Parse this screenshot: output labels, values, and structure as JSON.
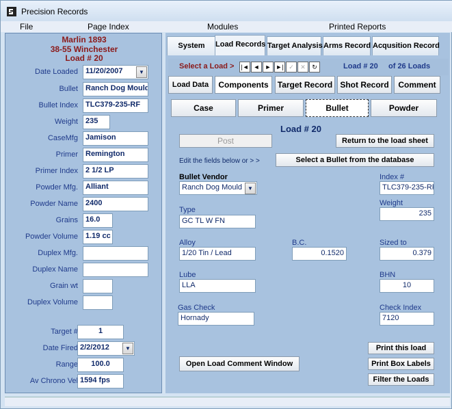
{
  "title": "Precision Records",
  "menu": [
    "File",
    "Page Index",
    "Modules",
    "Printed Reports"
  ],
  "left": {
    "heading1": "Marlin 1893",
    "heading2": "38-55 Winchester",
    "heading3": "Load #  20",
    "rows": [
      {
        "label": "Date Loaded",
        "value": "11/20/2007"
      },
      {
        "label": "Bullet",
        "value": "Ranch Dog Mould"
      },
      {
        "label": "Bullet Index",
        "value": "TLC379-235-RF"
      },
      {
        "label": "Weight",
        "value": "235"
      },
      {
        "label": "CaseMfg",
        "value": "Jamison"
      },
      {
        "label": "Primer",
        "value": "Remington"
      },
      {
        "label": "Primer Index",
        "value": "2 1/2 LP"
      },
      {
        "label": "Powder Mfg.",
        "value": "Alliant"
      },
      {
        "label": "Powder Name",
        "value": "2400"
      },
      {
        "label": "Grains",
        "value": "16.0"
      },
      {
        "label": "Powder Volume",
        "value": "1.19 cc"
      },
      {
        "label": "Duplex Mfg.",
        "value": ""
      },
      {
        "label": "Duplex Name",
        "value": ""
      },
      {
        "label": "Grain wt",
        "value": ""
      },
      {
        "label": "Duplex Volume",
        "value": ""
      },
      {
        "label": "Target #",
        "value": "1"
      },
      {
        "label": "Date Fired",
        "value": "2/2/2012"
      },
      {
        "label": "Range",
        "value": "100.0"
      },
      {
        "label": "Av Chrono Vel",
        "value": "1594 fps"
      }
    ]
  },
  "tabs": [
    "System",
    "Load Records",
    "Target Analysis",
    "Arms Record",
    "Acqusition Record"
  ],
  "nav": {
    "select_label": "Select a Load >",
    "load_label": "Load #  20",
    "of_label": "of 26 Loads"
  },
  "subtabs": [
    "Load Data",
    "Components",
    "Target Record",
    "Shot Record",
    "Comment"
  ],
  "component_tabs": [
    "Case",
    "Primer",
    "Bullet",
    "Powder"
  ],
  "load_no": "Load #  20",
  "post": "Post",
  "return": "Return to the load sheet",
  "edit_hint": "Edit the fields below or > >",
  "select_bullet": "Select a Bullet from the database",
  "fields": {
    "vendor_label": "Bullet Vendor",
    "vendor": "Ranch Dog Mould",
    "index_label": "Index #",
    "index": "TLC379-235-RF",
    "type_label": "Type",
    "type": "GC TL W FN",
    "weight_label": "Weight",
    "weight": "235",
    "alloy_label": "Alloy",
    "alloy": "1/20 Tin / Lead",
    "bc_label": "B.C.",
    "bc": "0.1520",
    "sized_label": "Sized to",
    "sized": "0.379",
    "lube_label": "Lube",
    "lube": "LLA",
    "bhn_label": "BHN",
    "bhn": "10",
    "gas_label": "Gas Check",
    "gas": "Hornady",
    "check_label": "Check Index",
    "check": "7120"
  },
  "buttons": {
    "comment": "Open Load Comment Window",
    "print_load": "Print this load",
    "print_box": "Print Box Labels",
    "filter": "Filter the Loads"
  }
}
